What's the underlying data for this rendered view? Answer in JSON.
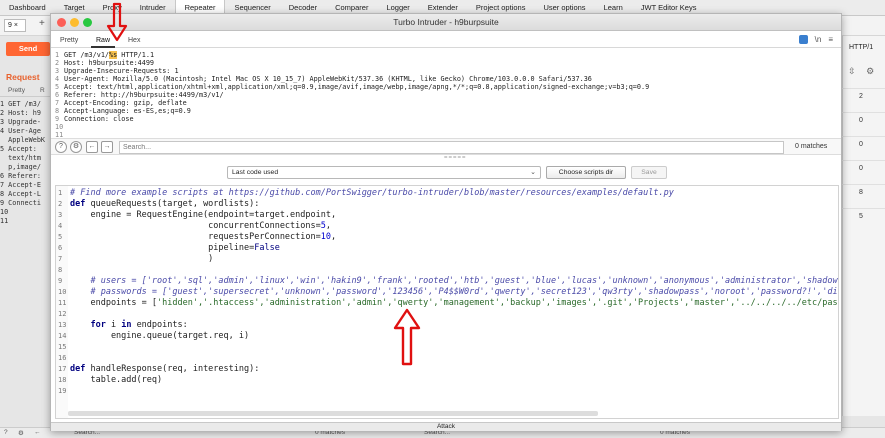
{
  "burp": {
    "tabs": [
      "Dashboard",
      "Target",
      "Proxy",
      "Intruder",
      "Repeater",
      "Sequencer",
      "Decoder",
      "Comparer",
      "Logger",
      "Extender",
      "Project options",
      "User options",
      "Learn",
      "JWT Editor Keys"
    ],
    "active_tab": "Repeater",
    "subtab": "9 ×",
    "plus": "+",
    "send_label": "Send",
    "request_label": "Request",
    "left_subtabs": [
      "Pretty",
      "R"
    ],
    "left_request_lines": [
      "1 GET /m3/",
      "2 Host: h9",
      "3 Upgrade-",
      "4 User-Age",
      "  AppleWebK",
      "5 Accept:",
      "  text/htm",
      "  p,image/",
      "6 Referer:",
      "7 Accept-E",
      "8 Accept-L",
      "9 Connecti",
      "10",
      "11"
    ],
    "http_label": "HTTP/1",
    "right_values": [
      "2",
      "0",
      "0",
      "0",
      "8",
      "5"
    ],
    "bottom_matches_1": "0 matches",
    "bottom_search_1": "Search...",
    "bottom_search_2": "Search...",
    "bottom_matches_2": "0 matches"
  },
  "turbo": {
    "title": "Turbo Intruder - h9burpsuite",
    "tabs": [
      "Pretty",
      "Raw",
      "Hex"
    ],
    "active_tab": "Raw",
    "tab_icons": [
      "blue-square-icon",
      "newline-icon",
      "menu-icon"
    ],
    "newline_glyph": "\\n",
    "menu_glyph": "≡",
    "request_lines": [
      {
        "n": "1",
        "pre": "GET /m3/v1/",
        "marker": "%s",
        "post": " HTTP/1.1"
      },
      {
        "n": "2",
        "pre": "Host: h9burpsuite:4499",
        "marker": "",
        "post": ""
      },
      {
        "n": "3",
        "pre": "Upgrade-Insecure-Requests: 1",
        "marker": "",
        "post": ""
      },
      {
        "n": "4",
        "pre": "User-Agent: Mozilla/5.0 (Macintosh; Intel Mac OS X 10_15_7) AppleWebKit/537.36 (KHTML, like Gecko) Chrome/103.0.0.0 Safari/537.36",
        "marker": "",
        "post": ""
      },
      {
        "n": "5",
        "pre": "Accept: text/html,application/xhtml+xml,application/xml;q=0.9,image/avif,image/webp,image/apng,*/*;q=0.8,application/signed-exchange;v=b3;q=0.9",
        "marker": "",
        "post": ""
      },
      {
        "n": "6",
        "pre": "Referer: http://h9burpsuite:4499/m3/v1/",
        "marker": "",
        "post": ""
      },
      {
        "n": "7",
        "pre": "Accept-Encoding: gzip, deflate",
        "marker": "",
        "post": ""
      },
      {
        "n": "8",
        "pre": "Accept-Language: es-ES,es;q=0.9",
        "marker": "",
        "post": ""
      },
      {
        "n": "9",
        "pre": "Connection: close",
        "marker": "",
        "post": ""
      },
      {
        "n": "10",
        "pre": "",
        "marker": "",
        "post": ""
      },
      {
        "n": "11",
        "pre": "",
        "marker": "",
        "post": ""
      }
    ],
    "search_placeholder": "Search...",
    "matches": "0 matches",
    "grip": "=====",
    "help_glyph": "?",
    "gear_glyph": "⚙",
    "back_glyph": "←",
    "forward_glyph": "→",
    "script_select": "Last code used",
    "select_chevron": "⌄",
    "choose_dir_label": "Choose scripts dir",
    "save_label": "Save",
    "code_lines": [
      {
        "n": "1",
        "parts": [
          [
            "cm",
            "# Find more example scripts at https://github.com/PortSwigger/turbo-intruder/blob/master/resources/examples/default.py"
          ]
        ]
      },
      {
        "n": "2",
        "parts": [
          [
            "kw",
            "def "
          ],
          [
            "",
            "queueRequests(target, wordlists):"
          ]
        ]
      },
      {
        "n": "3",
        "parts": [
          [
            "",
            "    engine = RequestEngine(endpoint=target.endpoint,"
          ]
        ]
      },
      {
        "n": "4",
        "parts": [
          [
            "",
            "                           concurrentConnections="
          ],
          [
            "nm",
            "5"
          ],
          [
            "",
            ","
          ]
        ]
      },
      {
        "n": "5",
        "parts": [
          [
            "",
            "                           requestsPerConnection="
          ],
          [
            "nm",
            "10"
          ],
          [
            "",
            ","
          ]
        ]
      },
      {
        "n": "6",
        "parts": [
          [
            "",
            "                           pipeline="
          ],
          [
            "bi",
            "False"
          ]
        ]
      },
      {
        "n": "7",
        "parts": [
          [
            "",
            "                           )"
          ]
        ]
      },
      {
        "n": "8",
        "parts": [
          [
            "",
            ""
          ]
        ]
      },
      {
        "n": "9",
        "parts": [
          [
            "cm",
            "    # users = ['root','sql','admin','linux','win','hakin9','frank','rooted','htb','guest','blue','lucas','unknown','anonymous','administrator','shadow','_p"
          ]
        ]
      },
      {
        "n": "10",
        "parts": [
          [
            "cm",
            "    # passwords = ['guest','supersecret','unknown','password','123456','P4$$W0rd','qwerty','secret123','qw3rty','shadowpass','noroot','password?!','diffpas"
          ]
        ]
      },
      {
        "n": "11",
        "parts": [
          [
            "",
            "    endpoints = ["
          ],
          [
            "st",
            "'hidden','.htaccess','administration','admin','qwerty','management','backup','images','.git','Projects','master','../../../../etc/passwd',"
          ]
        ]
      },
      {
        "n": "12",
        "parts": [
          [
            "",
            ""
          ]
        ]
      },
      {
        "n": "13",
        "parts": [
          [
            "kw",
            "    for "
          ],
          [
            "",
            "i "
          ],
          [
            "kw",
            "in "
          ],
          [
            "",
            "endpoints:"
          ]
        ]
      },
      {
        "n": "14",
        "parts": [
          [
            "",
            "        engine.queue(target.req, i)"
          ]
        ]
      },
      {
        "n": "15",
        "parts": [
          [
            "",
            ""
          ]
        ]
      },
      {
        "n": "16",
        "parts": [
          [
            "",
            ""
          ]
        ]
      },
      {
        "n": "17",
        "parts": [
          [
            "kw",
            "def "
          ],
          [
            "",
            "handleResponse(req, interesting):"
          ]
        ]
      },
      {
        "n": "18",
        "parts": [
          [
            "",
            "    table.add(req)"
          ]
        ]
      },
      {
        "n": "19",
        "parts": [
          [
            "",
            ""
          ]
        ]
      }
    ],
    "attack_label": "Attack"
  },
  "colors": {
    "annotation_arrow": "#e01010",
    "burp_orange": "#ff6633",
    "payload_marker": "#f6c04d"
  }
}
